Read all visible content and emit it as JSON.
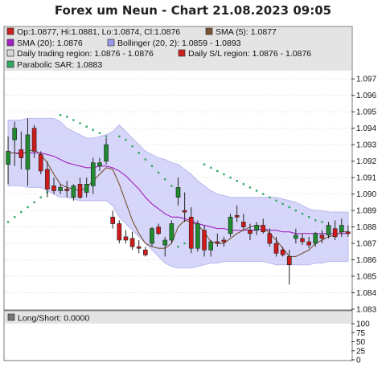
{
  "chart_data": {
    "title": "Forex um Neun - Chart 21.08.2023 09:05",
    "type": "candlestick",
    "ylim": [
      1.083,
      1.0975
    ],
    "y_ticks": [
      "1.097",
      "1.096",
      "1.095",
      "1.094",
      "1.093",
      "1.092",
      "1.091",
      "1.090",
      "1.089",
      "1.088",
      "1.087",
      "1.086",
      "1.085",
      "1.084",
      "1.083"
    ],
    "legend": [
      {
        "label": "Op:1.0877, Hi:1.0881, Lo:1.0874, Cl:1.0876",
        "color": "#cc1f1f"
      },
      {
        "label": "SMA (5): 1.0877",
        "color": "#7a5230"
      },
      {
        "label": "SMA (20): 1.0876",
        "color": "#a020c0"
      },
      {
        "label": "Bollinger (20, 2): 1.0859 - 1.0893",
        "color": "#9a9ae8"
      },
      {
        "label": "Daily trading region: 1.0876 - 1.0876",
        "color": "#d8d8d8"
      },
      {
        "label": "Daily S/L region: 1.0876 - 1.0876",
        "color": "#cc1f1f"
      },
      {
        "label": "Parabolic SAR: 1.0883",
        "color": "#2fa860"
      }
    ],
    "candles": [
      [
        1.0918,
        1.0935,
        1.0906,
        1.0926
      ],
      [
        1.0933,
        1.0944,
        1.0917,
        1.094
      ],
      [
        1.0927,
        1.0938,
        1.0915,
        1.0922
      ],
      [
        1.0915,
        1.0946,
        1.0905,
        1.0936
      ],
      [
        1.094,
        1.0942,
        1.0922,
        1.0926
      ],
      [
        1.0924,
        1.0926,
        1.0912,
        1.0914
      ],
      [
        1.0915,
        1.092,
        1.0898,
        1.0903
      ],
      [
        1.0905,
        1.091,
        1.09,
        1.0902
      ],
      [
        1.0902,
        1.0906,
        1.09,
        1.0904
      ],
      [
        1.0903,
        1.0908,
        1.0898,
        1.0902
      ],
      [
        1.0898,
        1.0906,
        1.0896,
        1.0905
      ],
      [
        1.0906,
        1.091,
        1.0897,
        1.0898
      ],
      [
        1.0901,
        1.091,
        1.0898,
        1.0906
      ],
      [
        1.0905,
        1.0922,
        1.09,
        1.0919
      ],
      [
        1.0917,
        1.0922,
        1.0914,
        1.0919
      ],
      [
        1.092,
        1.0934,
        1.0918,
        1.093
      ],
      [
        1.0886,
        1.089,
        1.0879,
        1.0882
      ],
      [
        1.0882,
        1.0884,
        1.087,
        1.0872
      ],
      [
        1.0874,
        1.0878,
        1.087,
        1.0872
      ],
      [
        1.0873,
        1.0877,
        1.0866,
        1.0868
      ],
      [
        1.0868,
        1.0872,
        1.0864,
        1.0867
      ],
      [
        1.0866,
        1.0868,
        1.0862,
        1.0863
      ],
      [
        1.087,
        1.088,
        1.0868,
        1.0879
      ],
      [
        1.088,
        1.0882,
        1.0875,
        1.0876
      ],
      [
        1.0869,
        1.0874,
        1.0862,
        1.0872
      ],
      [
        1.0872,
        1.0884,
        1.087,
        1.0882
      ],
      [
        1.0898,
        1.091,
        1.0893,
        1.0904
      ],
      [
        1.089,
        1.0901,
        1.0883,
        1.0889
      ],
      [
        1.0886,
        1.0892,
        1.0864,
        1.0867
      ],
      [
        1.0867,
        1.0884,
        1.0865,
        1.0882
      ],
      [
        1.0878,
        1.0881,
        1.0862,
        1.0866
      ],
      [
        1.0866,
        1.0872,
        1.0862,
        1.0871
      ],
      [
        1.0871,
        1.0876,
        1.0868,
        1.087
      ],
      [
        1.0872,
        1.0874,
        1.0868,
        1.0871
      ],
      [
        1.0876,
        1.0888,
        1.0874,
        1.0886
      ],
      [
        1.0887,
        1.0893,
        1.0883,
        1.0886
      ],
      [
        1.0883,
        1.0888,
        1.0878,
        1.088
      ],
      [
        1.0878,
        1.0882,
        1.0872,
        1.0876
      ],
      [
        1.0878,
        1.0883,
        1.0875,
        1.0881
      ],
      [
        1.0881,
        1.0885,
        1.0876,
        1.0877
      ],
      [
        1.0876,
        1.0879,
        1.0868,
        1.087
      ],
      [
        1.087,
        1.0874,
        1.0862,
        1.0864
      ],
      [
        1.0866,
        1.0868,
        1.0862,
        1.0863
      ],
      [
        1.0862,
        1.0866,
        1.0845,
        1.0857
      ],
      [
        1.0873,
        1.0879,
        1.087,
        1.0875
      ],
      [
        1.0873,
        1.0876,
        1.0869,
        1.0871
      ],
      [
        1.0871,
        1.0874,
        1.0867,
        1.0869
      ],
      [
        1.087,
        1.0877,
        1.0868,
        1.0876
      ],
      [
        1.0875,
        1.0878,
        1.087,
        1.0873
      ],
      [
        1.0875,
        1.0883,
        1.0873,
        1.0881
      ],
      [
        1.0879,
        1.0884,
        1.0872,
        1.0874
      ],
      [
        1.0877,
        1.0885,
        1.0874,
        1.0881
      ],
      [
        1.0877,
        1.0881,
        1.0874,
        1.0876
      ]
    ],
    "sma5": [
      1.0925,
      1.0925,
      1.0924,
      1.0926,
      1.0927,
      1.0924,
      1.0919,
      1.0912,
      1.0906,
      1.0904,
      1.0903,
      1.0902,
      1.0904,
      1.0908,
      1.0912,
      1.0916,
      1.0915,
      1.0906,
      1.0895,
      1.0884,
      1.0876,
      1.087,
      1.0868,
      1.0867,
      1.0867,
      1.087,
      1.088,
      1.0884,
      1.0883,
      1.0881,
      1.0877,
      1.0871,
      1.087,
      1.087,
      1.0873,
      1.0876,
      1.0878,
      1.088,
      1.0881,
      1.088,
      1.0876,
      1.0872,
      1.0867,
      1.0862,
      1.0862,
      1.0864,
      1.0866,
      1.087,
      1.0872,
      1.0874,
      1.0875,
      1.0877,
      1.0877
    ],
    "sma20": [
      1.0925,
      1.0925,
      1.0925,
      1.0925,
      1.0925,
      1.0925,
      1.0924,
      1.0923,
      1.0921,
      1.0919,
      1.0918,
      1.0917,
      1.0916,
      1.0916,
      1.0917,
      1.0917,
      1.0916,
      1.0914,
      1.0911,
      1.0907,
      1.0903,
      1.0898,
      1.0894,
      1.0891,
      1.0888,
      1.0886,
      1.0886,
      1.0885,
      1.0884,
      1.0882,
      1.0881,
      1.088,
      1.0879,
      1.0879,
      1.0878,
      1.0878,
      1.0878,
      1.0878,
      1.0878,
      1.0879,
      1.0878,
      1.0878,
      1.0877,
      1.0877,
      1.0876,
      1.0876,
      1.0876,
      1.0876,
      1.0876,
      1.0876,
      1.0876,
      1.0876,
      1.0876
    ],
    "bb_upper": [
      1.0945,
      1.0945,
      1.0945,
      1.0946,
      1.0946,
      1.0946,
      1.0946,
      1.0946,
      1.0944,
      1.094,
      1.0938,
      1.0936,
      1.0934,
      1.0934,
      1.0935,
      1.0936,
      1.0938,
      1.0942,
      1.0938,
      1.0934,
      1.093,
      1.0926,
      1.0924,
      1.0922,
      1.0921,
      1.0919,
      1.0918,
      1.0915,
      1.0912,
      1.0908,
      1.0905,
      1.0902,
      1.09,
      1.0899,
      1.0898,
      1.0898,
      1.0898,
      1.0898,
      1.0898,
      1.0898,
      1.0898,
      1.0898,
      1.0897,
      1.0896,
      1.0895,
      1.0893,
      1.0891,
      1.089,
      1.089,
      1.0889,
      1.0889,
      1.0889,
      1.0889
    ],
    "bb_lower": [
      1.0905,
      1.0905,
      1.0905,
      1.0904,
      1.0904,
      1.0904,
      1.0902,
      1.09,
      1.0898,
      1.0898,
      1.0897,
      1.0896,
      1.0896,
      1.0896,
      1.0896,
      1.0896,
      1.0893,
      1.0886,
      1.0882,
      1.0878,
      1.0874,
      1.087,
      1.0866,
      1.0862,
      1.0858,
      1.0856,
      1.0855,
      1.0855,
      1.0855,
      1.0856,
      1.0857,
      1.0858,
      1.0858,
      1.0859,
      1.0859,
      1.0859,
      1.0859,
      1.0859,
      1.0859,
      1.0859,
      1.0858,
      1.0857,
      1.0857,
      1.0857,
      1.0857,
      1.0857,
      1.0857,
      1.0858,
      1.0858,
      1.0859,
      1.0859,
      1.0859,
      1.0859
    ],
    "sar": [
      1.0883,
      1.0886,
      1.0889,
      1.0892,
      1.0895,
      1.0898,
      1.0901,
      null,
      1.0948,
      1.0947,
      1.0945,
      1.0943,
      1.0941,
      1.0939,
      1.0937,
      1.0935,
      null,
      1.0935,
      1.0933,
      1.0929,
      1.0925,
      1.0921,
      1.0917,
      1.0913,
      1.0909,
      1.0905,
      1.0868,
      1.087,
      1.0872,
      null,
      1.0918,
      1.0916,
      1.0914,
      1.0912,
      1.091,
      1.0908,
      1.0906,
      1.0904,
      1.0902,
      1.09,
      1.0898,
      1.0896,
      1.0894,
      1.0892,
      1.089,
      1.0888,
      1.0886,
      1.0884,
      1.0883,
      null,
      null,
      null,
      null
    ],
    "sub_panel": {
      "legend": "Long/Short: 0.0000",
      "ylim": [
        0,
        100
      ],
      "y_ticks": [
        "100",
        "75",
        "50",
        "25",
        "0"
      ]
    }
  }
}
